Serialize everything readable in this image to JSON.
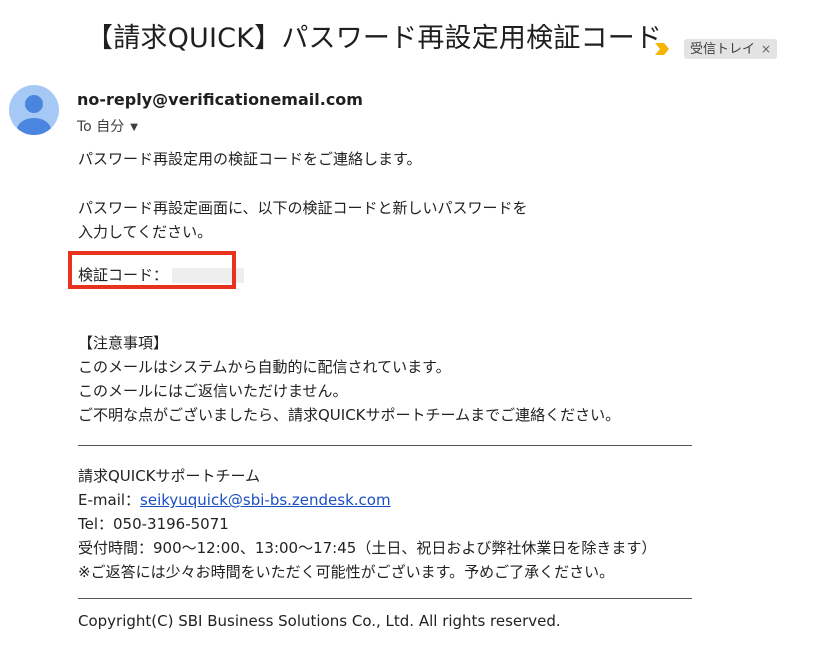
{
  "email": {
    "subject": "【請求QUICK】パスワード再設定用検証コード",
    "label": "受信トレイ",
    "label_close": "×",
    "sender": "no-reply@verificationemail.com",
    "recipient": "To 自分",
    "body": {
      "intro": "パスワード再設定用の検証コードをご連絡します。",
      "instruction_line1": "パスワード再設定画面に、以下の検証コードと新しいパスワードを",
      "instruction_line2": "入力してください。",
      "code_label": "検証コード：",
      "notice_heading": "【注意事項】",
      "notice_lines": [
        "このメールはシステムから自動的に配信されています。",
        "このメールにはご返信いただけません。",
        "ご不明な点がございましたら、請求QUICKサポートチームまでご連絡ください。"
      ],
      "signature": {
        "team": "請求QUICKサポートチーム",
        "email_label": "E-mail：",
        "email": "seikyuquick@sbi-bs.zendesk.com",
        "tel": "Tel：050-3196-5071",
        "hours": "受付時間：900〜12:00、13:00〜17:45（土日、祝日および弊社休業日を除きます）",
        "note": "※ご返答には少々お時間をいただく可能性がございます。予めご了承ください。"
      },
      "copyright": "Copyright(C) SBI Business Solutions Co., Ltd. All rights reserved."
    }
  },
  "colors": {
    "highlight_box": "#e8321e",
    "importance_marker": "#f4b400",
    "avatar_bg": "#a6c8f5",
    "avatar_fg": "#4a86e0",
    "link": "#1a4fc4"
  },
  "icons": {
    "importance": "importance-marker-icon",
    "avatar": "person-avatar-icon",
    "caret": "chevron-down-icon"
  }
}
